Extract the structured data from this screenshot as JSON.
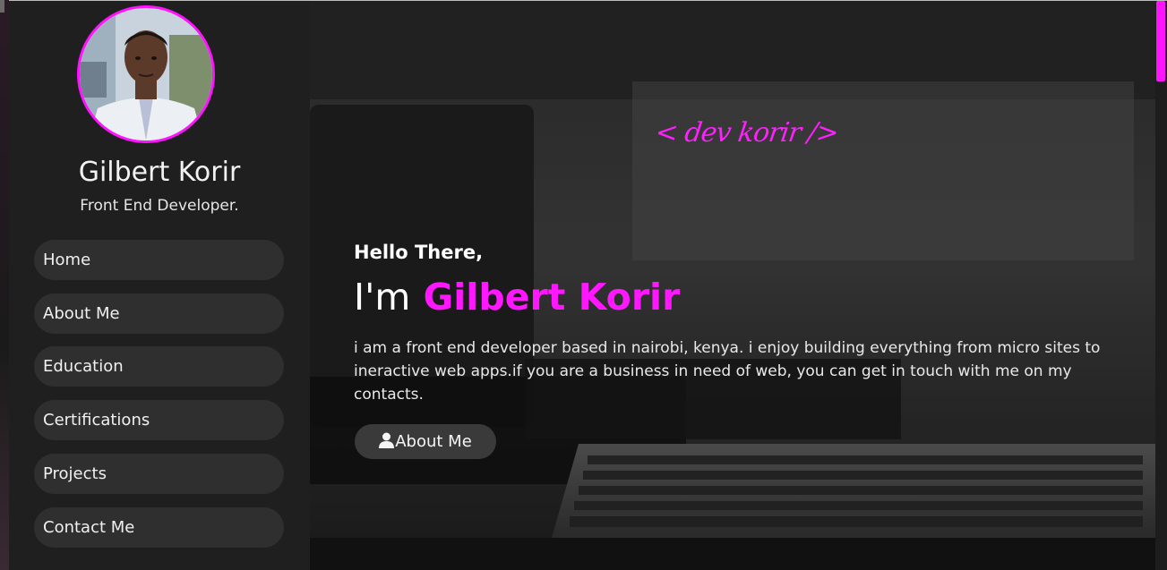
{
  "profile": {
    "name": "Gilbert Korir",
    "role": "Front End Developer."
  },
  "nav": {
    "items": [
      {
        "label": "Home"
      },
      {
        "label": "About Me"
      },
      {
        "label": "Education"
      },
      {
        "label": "Certifications"
      },
      {
        "label": "Projects"
      },
      {
        "label": "Contact Me"
      }
    ]
  },
  "hero": {
    "logo": "< dev korir />",
    "greeting": "Hello There,",
    "headline_prefix": "I'm",
    "headline_name": "Gilbert Korir",
    "bio": "i am a front end developer based in nairobi, kenya. i enjoy building everything from micro sites to ineractive web apps.if you are a business in need of web, you can get in touch with me on my contacts.",
    "cta_label": "About Me",
    "cta_icon": "user-icon"
  },
  "colors": {
    "accent": "#ff17ff",
    "sidebar_bg": "#1f1f1f",
    "nav_item_bg": "#2f2f2f"
  }
}
